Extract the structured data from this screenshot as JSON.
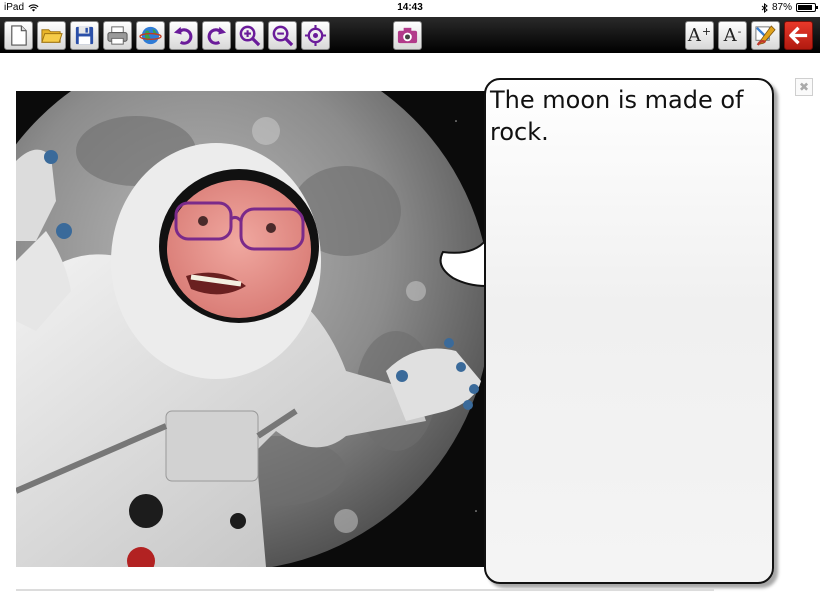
{
  "status_bar": {
    "device": "iPad",
    "time": "14:43",
    "battery_percent": "87%",
    "battery_level": 0.87
  },
  "toolbar": {
    "left_tools": [
      {
        "name": "new-page-button",
        "icon": "blank-page-icon"
      },
      {
        "name": "open-folder-button",
        "icon": "folder-icon"
      },
      {
        "name": "save-button",
        "icon": "floppy-disk-icon"
      },
      {
        "name": "print-button",
        "icon": "printer-icon"
      },
      {
        "name": "share-button",
        "icon": "globe-icon"
      },
      {
        "name": "undo-button",
        "icon": "undo-arrow-icon"
      },
      {
        "name": "redo-button",
        "icon": "redo-arrow-icon"
      },
      {
        "name": "zoom-in-button",
        "icon": "magnifier-plus-icon"
      },
      {
        "name": "zoom-out-button",
        "icon": "magnifier-minus-icon"
      },
      {
        "name": "center-view-button",
        "icon": "target-icon"
      }
    ],
    "camera_icon": "camera-icon",
    "font_increase_label": "A",
    "font_increase_sup": "+",
    "font_decrease_label": "A",
    "font_decrease_sup": "-",
    "style_icon": "paint-tools-icon",
    "exit_icon": "back-arrow-icon"
  },
  "content": {
    "close_label": "✖",
    "speech_text": "The moon is made of rock.",
    "photo_description_icon": "astronaut-moon-photo"
  },
  "colors": {
    "toolbar_bg": "#000000",
    "accent_purple": "#6a1b9a",
    "exit_red": "#d42a1c"
  }
}
